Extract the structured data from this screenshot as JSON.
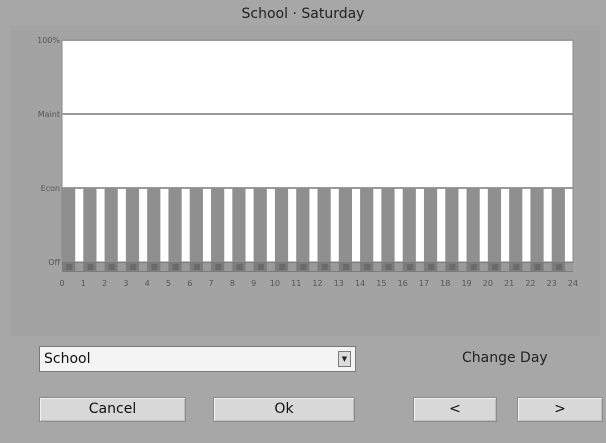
{
  "window": {
    "title": "School · Saturday"
  },
  "chart_data": {
    "type": "bar",
    "title": "School · Saturday",
    "y_levels": [
      "Off",
      "Econ",
      "Maint",
      "100%"
    ],
    "x_ticks": [
      "0",
      "1",
      "2",
      "3",
      "4",
      "5",
      "6",
      "7",
      "8",
      "9",
      "10",
      "11",
      "12",
      "13",
      "14",
      "15",
      "16",
      "17",
      "18",
      "19",
      "20",
      "21",
      "22",
      "23",
      "24"
    ],
    "categories": [
      "0",
      "1",
      "2",
      "3",
      "4",
      "5",
      "6",
      "7",
      "8",
      "9",
      "10",
      "11",
      "12",
      "13",
      "14",
      "15",
      "16",
      "17",
      "18",
      "19",
      "20",
      "21",
      "22",
      "23"
    ],
    "values": [
      1,
      1,
      1,
      1,
      1,
      1,
      1,
      1,
      1,
      1,
      1,
      1,
      1,
      1,
      1,
      1,
      1,
      1,
      1,
      1,
      1,
      1,
      1,
      1
    ],
    "value_scale": {
      "Off": 0,
      "Econ": 1,
      "Maint": 2,
      "100%": 3
    },
    "ylim": [
      0,
      3
    ],
    "grid": true,
    "colors": {
      "bar": "#8f8f8f",
      "plot_bg": "#ffffff",
      "grid": "#9a9a9a",
      "base": "#6a6a6a"
    }
  },
  "controls": {
    "schedule_select": {
      "value": "School"
    },
    "change_day_label": "Change Day",
    "cancel_label": "Cancel",
    "ok_label": "Ok",
    "prev_label": "<",
    "next_label": ">"
  }
}
